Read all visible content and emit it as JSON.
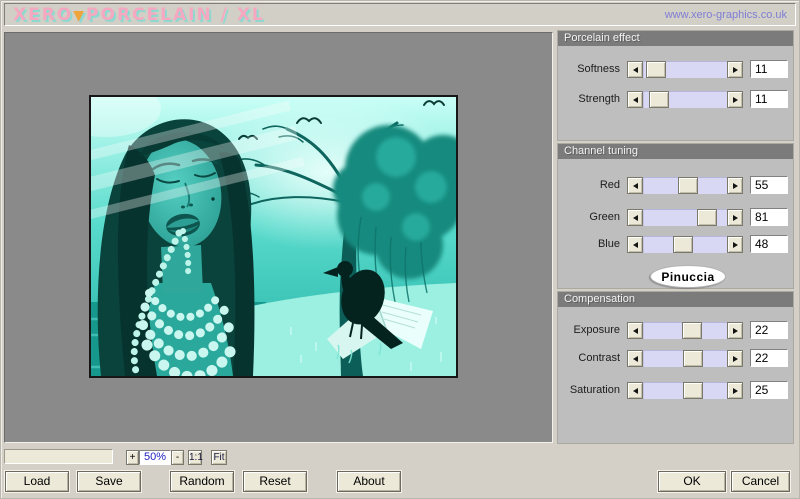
{
  "window": {
    "title_left": "XERO",
    "title_divider": "▼",
    "title_right": "PORCELAIN / XL",
    "website_link": "www.xero-graphics.co.uk"
  },
  "panels": [
    {
      "title": "Porcelain effect",
      "sliders": [
        {
          "label": "Softness",
          "value": "11",
          "pos": 0.04
        },
        {
          "label": "Strength",
          "value": "11",
          "pos": 0.1
        }
      ]
    },
    {
      "title": "Channel tuning",
      "sliders": [
        {
          "label": "Red",
          "value": "55",
          "pos": 0.55
        },
        {
          "label": "Green",
          "value": "81",
          "pos": 0.84
        },
        {
          "label": "Blue",
          "value": "48",
          "pos": 0.47
        }
      ],
      "badge": "Pinuccia"
    },
    {
      "title": "Compensation",
      "sliders": [
        {
          "label": "Exposure",
          "value": "22",
          "pos": 0.61
        },
        {
          "label": "Contrast",
          "value": "22",
          "pos": 0.62
        },
        {
          "label": "Saturation",
          "value": "25",
          "pos": 0.63
        }
      ]
    }
  ],
  "zoom_bar": {
    "progress_value": "",
    "zoom_in_label": "+",
    "zoom_level": "50%",
    "zoom_out_label": "-",
    "actual_size_label": "1:1",
    "fit_label": "Fit"
  },
  "action_buttons": {
    "load": "Load",
    "save": "Save",
    "random": "Random",
    "reset": "Reset",
    "about": "About",
    "ok": "OK",
    "cancel": "Cancel"
  },
  "preview": {
    "description": "Cyan-toned photo montage: woman with pearl necklace in her mouth, bare tree with willow foliage, raven perched on an open book, flying birds",
    "tint_color": "#2fb9ad"
  },
  "colors": {
    "dialog_bg": "#d4d0c8",
    "preview_bg": "#8a8a8a",
    "group_body": "#bebebe",
    "group_header": "#7b7b7b",
    "slider_track": "#d8d8f4",
    "control_face": "#ece9d8",
    "title_pink": "#f5a8c0",
    "title_shadow": "#8fd8d0",
    "link_blue": "#7e7ed6",
    "zoom_text_blue": "#2020c0"
  }
}
